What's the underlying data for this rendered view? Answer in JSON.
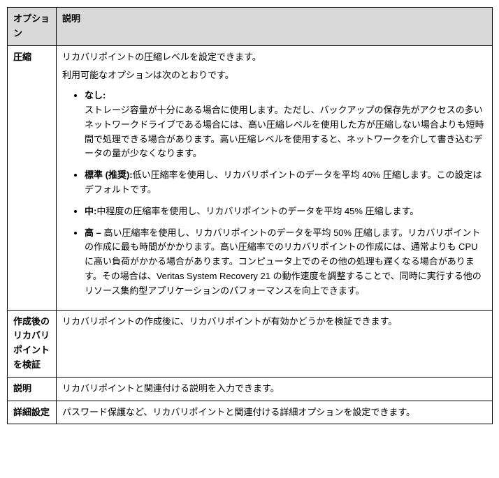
{
  "header": {
    "col1": "オプション",
    "col2": "説明"
  },
  "rows": {
    "compression": {
      "title": "圧縮",
      "intro1": "リカバリポイントの圧縮レベルを設定できます。",
      "intro2": "利用可能なオプションは次のとおりです。",
      "none_label": "なし:",
      "none_body": "ストレージ容量が十分にある場合に使用します。ただし、バックアップの保存先がアクセスの多いネットワークドライブである場合には、高い圧縮レベルを使用した方が圧縮しない場合よりも短時間で処理できる場合があります。高い圧縮レベルを使用すると、ネットワークを介して書き込むデータの量が少なくなります。",
      "std_label": "標準 (推奨):",
      "std_body": "低い圧縮率を使用し、リカバリポイントのデータを平均 40% 圧縮します。この設定はデフォルトです。",
      "mid_label": "中:",
      "mid_body": "中程度の圧縮率を使用し、リカバリポイントのデータを平均 45% 圧縮します。",
      "high_label": "高 – ",
      "high_body": "高い圧縮率を使用し、リカバリポイントのデータを平均 50% 圧縮します。リカバリポイントの作成に最も時間がかかります。高い圧縮率でのリカバリポイントの作成には、通常よりも CPU に高い負荷がかかる場合があります。コンピュータ上でのその他の処理も遅くなる場合があります。その場合は、Veritas System Recovery 21 の動作速度を調整することで、同時に実行する他のリソース集約型アプリケーションのパフォーマンスを向上できます。"
    },
    "verify": {
      "title": "作成後のリカバリポイントを検証",
      "body": "リカバリポイントの作成後に、リカバリポイントが有効かどうかを検証できます。"
    },
    "desc": {
      "title": "説明",
      "body": "リカバリポイントと関連付ける説明を入力できます。"
    },
    "advanced": {
      "title": "詳細設定",
      "body": "パスワード保護など、リカバリポイントと関連付ける詳細オプションを設定できます。"
    }
  }
}
